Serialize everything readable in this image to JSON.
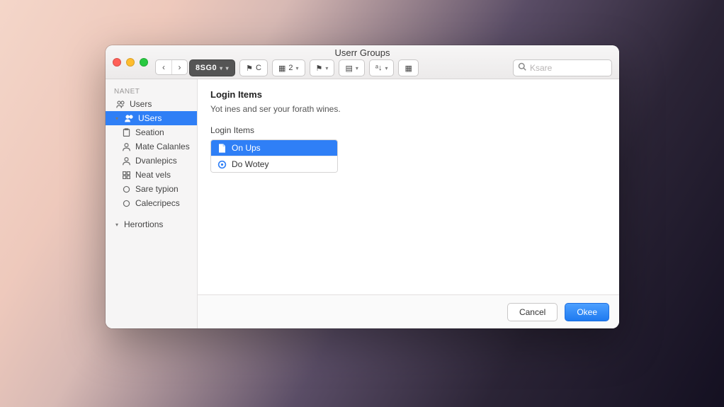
{
  "window": {
    "title": "Userr Groups"
  },
  "toolbar": {
    "segmented_label": "8SG0",
    "btn_c": "C",
    "btn_2": "2",
    "search_placeholder": "Ksare"
  },
  "sidebar": {
    "header": "NANET",
    "items": [
      {
        "icon": "users",
        "label": "Users",
        "selected": false,
        "sub": false
      },
      {
        "icon": "users",
        "label": "USers",
        "selected": true,
        "sub": false,
        "expandable": true
      },
      {
        "icon": "clipboard",
        "label": "Seation",
        "selected": false,
        "sub": true
      },
      {
        "icon": "person",
        "label": "Mate Calanles",
        "selected": false,
        "sub": true
      },
      {
        "icon": "person",
        "label": "Dvanlepics",
        "selected": false,
        "sub": true
      },
      {
        "icon": "grid",
        "label": "Neat vels",
        "selected": false,
        "sub": true
      },
      {
        "icon": "circle",
        "label": "Sare typion",
        "selected": false,
        "sub": true
      },
      {
        "icon": "circle",
        "label": "Calecripecs",
        "selected": false,
        "sub": true
      }
    ],
    "group2_label": "Herortions"
  },
  "main": {
    "heading": "Login Items",
    "description": "Yot ines and ser your forath wines.",
    "list_label": "Login Items",
    "login_items": [
      {
        "icon": "doc",
        "label": "On Ups",
        "selected": true
      },
      {
        "icon": "disc",
        "label": "Do Wotey",
        "selected": false
      }
    ]
  },
  "footer": {
    "cancel": "Cancel",
    "ok": "Okee"
  }
}
